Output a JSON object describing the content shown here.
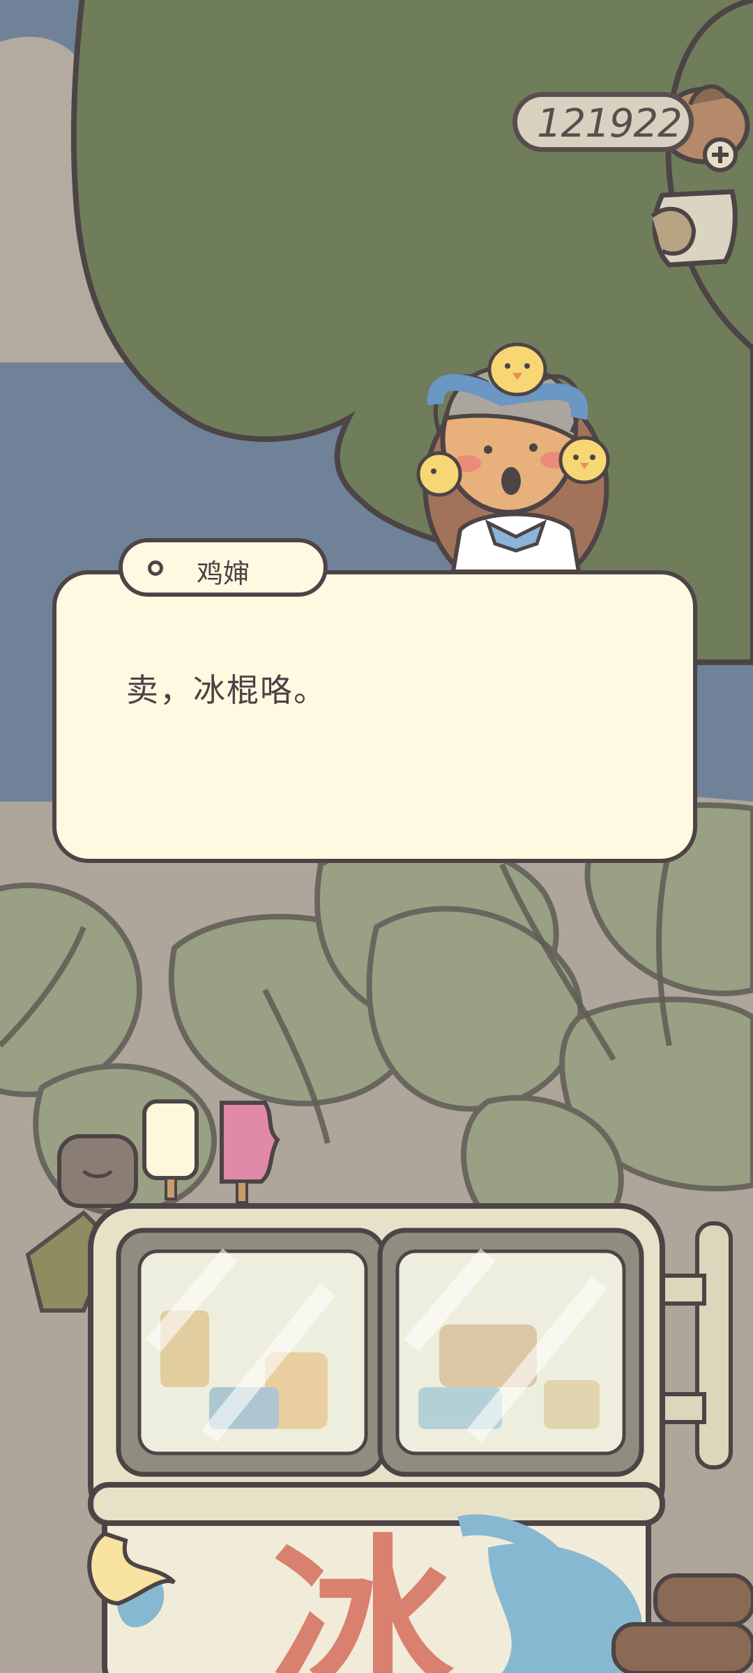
{
  "hud": {
    "currency_amount": "121922",
    "currency_icon": "clover-coin-icon",
    "add_icon": "plus-icon",
    "info_icon": "book-icon"
  },
  "dialog": {
    "speaker_name": "鸡婶",
    "message": "卖，冰棍咯。"
  },
  "stall": {
    "sign_text": "冰"
  },
  "colors": {
    "sky": "#6f8297",
    "tree": "#6f7d5b",
    "outline": "#4d4446",
    "dialog_bg": "#fff9e1",
    "freezer": "#e7e2c7",
    "sign_red": "#d9806f",
    "sign_blue": "#86b8d2"
  }
}
